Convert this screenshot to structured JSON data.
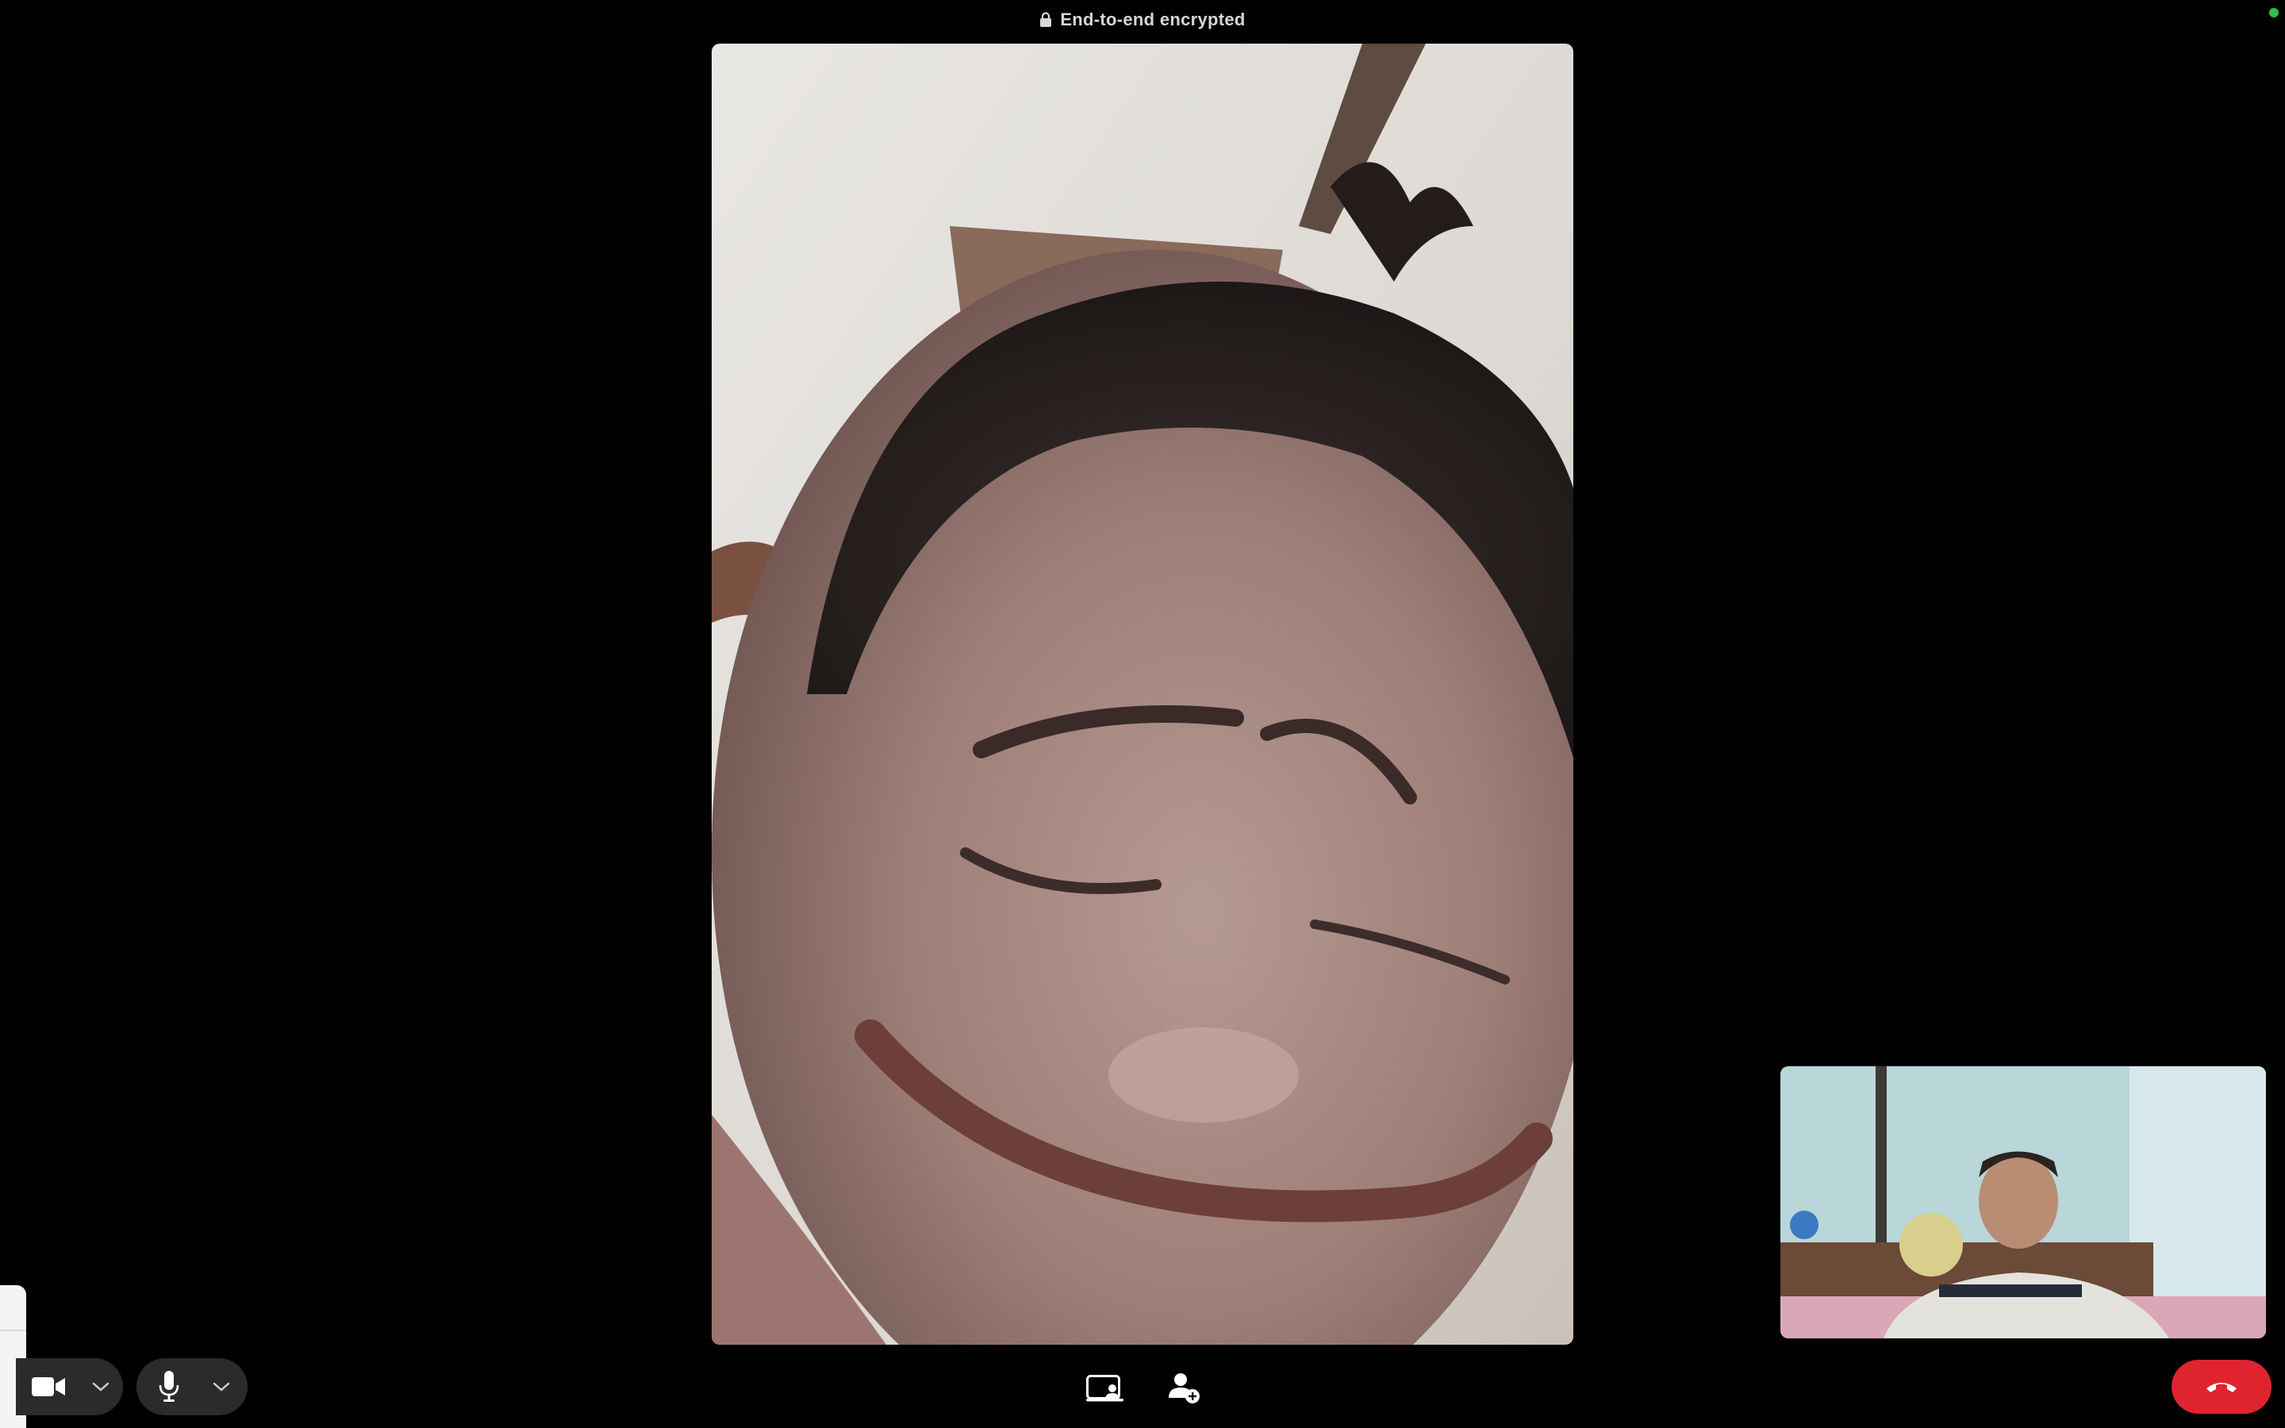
{
  "banner": {
    "text": "End-to-end encrypted",
    "icon": "lock-icon"
  },
  "status": {
    "color": "#2fbf4a"
  },
  "controls": {
    "video_icon": "video-camera-icon",
    "video_menu_icon": "chevron-down-icon",
    "mic_icon": "microphone-icon",
    "mic_menu_icon": "chevron-down-icon",
    "screen_share_icon": "screen-share-icon",
    "add_participant_icon": "add-person-icon",
    "end_call_icon": "phone-hangup-icon",
    "end_call_color": "#e0242f"
  },
  "colors": {
    "background": "#000000",
    "pill": "#2b2b2b",
    "icon": "#ffffff"
  }
}
